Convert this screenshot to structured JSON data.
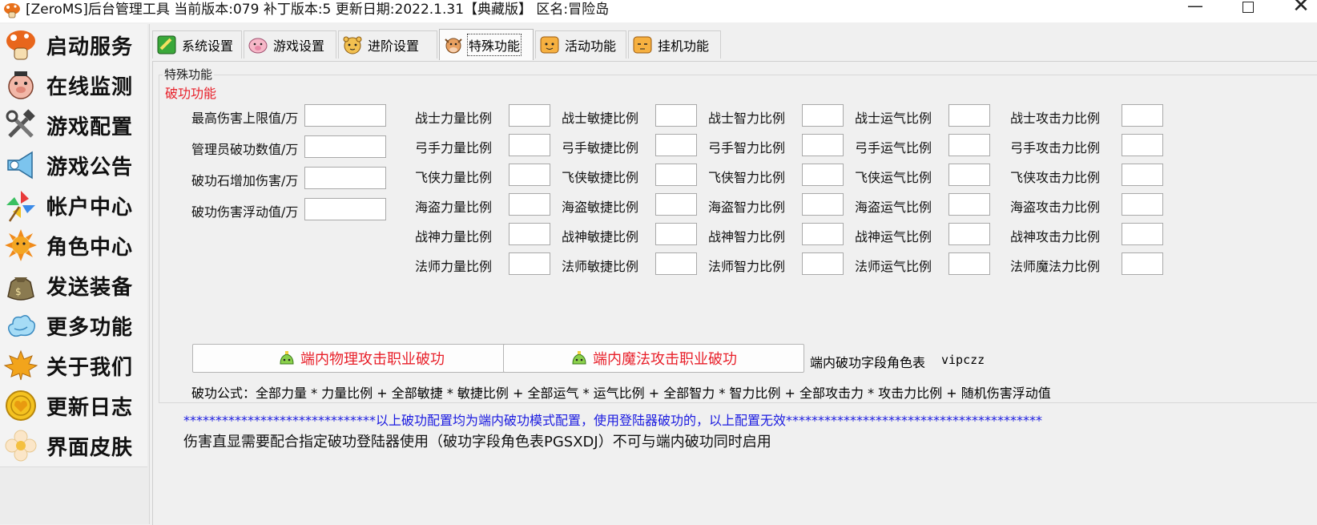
{
  "window": {
    "title": "[ZeroMS]后台管理工具 当前版本:079 补丁版本:5 更新日期:2022.1.31【典藏版】 区名:冒险岛",
    "minimize": "—",
    "close": "✕"
  },
  "sidebar": {
    "items": [
      {
        "label": "启动服务",
        "icon": "mushroom-icon"
      },
      {
        "label": "在线监测",
        "icon": "pig-icon"
      },
      {
        "label": "游戏配置",
        "icon": "tools-icon"
      },
      {
        "label": "游戏公告",
        "icon": "megaphone-icon"
      },
      {
        "label": "帐户中心",
        "icon": "pinwheel-icon"
      },
      {
        "label": "角色中心",
        "icon": "sun-icon"
      },
      {
        "label": "发送装备",
        "icon": "bag-icon"
      },
      {
        "label": "更多功能",
        "icon": "cloud-icon"
      },
      {
        "label": "关于我们",
        "icon": "maple-leaf-icon"
      },
      {
        "label": "更新日志",
        "icon": "coin-icon"
      },
      {
        "label": "界面皮肤",
        "icon": "flower-icon"
      }
    ]
  },
  "tabs": [
    {
      "label": "系统设置",
      "icon": "green-check-icon"
    },
    {
      "label": "游戏设置",
      "icon": "pig-icon"
    },
    {
      "label": "进阶设置",
      "icon": "tiger-icon"
    },
    {
      "label": "特殊功能",
      "icon": "cow-icon"
    },
    {
      "label": "活动功能",
      "icon": "orange-face-icon"
    },
    {
      "label": "挂机功能",
      "icon": "orange-face-icon"
    }
  ],
  "panel": {
    "group_title": "特殊功能",
    "sub_title": "破功功能",
    "left_fields": [
      {
        "label": "最高伤害上限值/万",
        "value": ""
      },
      {
        "label": "管理员破功数值/万",
        "value": ""
      },
      {
        "label": "破功石增加伤害/万",
        "value": ""
      },
      {
        "label": "破功伤害浮动值/万",
        "value": ""
      }
    ],
    "ratio_rows": [
      [
        "战士力量比例",
        "战士敏捷比例",
        "战士智力比例",
        "战士运气比例",
        "战士攻击力比例"
      ],
      [
        "弓手力量比例",
        "弓手敏捷比例",
        "弓手智力比例",
        "弓手运气比例",
        "弓手攻击力比例"
      ],
      [
        "飞侠力量比例",
        "飞侠敏捷比例",
        "飞侠智力比例",
        "飞侠运气比例",
        "飞侠攻击力比例"
      ],
      [
        "海盗力量比例",
        "海盗敏捷比例",
        "海盗智力比例",
        "海盗运气比例",
        "海盗攻击力比例"
      ],
      [
        "战神力量比例",
        "战神敏捷比例",
        "战神智力比例",
        "战神运气比例",
        "战神攻击力比例"
      ],
      [
        "法师力量比例",
        "法师敏捷比例",
        "法师智力比例",
        "法师运气比例",
        "法师魔法力比例"
      ]
    ],
    "btn_physical": "端内物理攻击职业破功",
    "btn_magic": "端内魔法攻击职业破功",
    "field_table_label": "端内破功字段角色表",
    "field_table_value": "vipczz",
    "formula": "破功公式：全部力量 * 力量比例 + 全部敏捷 * 敏捷比例 + 全部运气 * 运气比例 + 全部智力 * 智力比例 + 全部攻击力 * 攻击力比例    + 随机伤害浮动值",
    "notice_blue": "******************************以上破功配置均为端内破功模式配置，使用登陆器破功的，以上配置无效****************************************",
    "notice_black": "伤害直显需要配合指定破功登陆器使用（破功字段角色表PGSXDJ）不可与端内破功同时启用"
  },
  "colors": {
    "accent_red": "#e8202a",
    "notice_blue": "#1a1ae0"
  }
}
